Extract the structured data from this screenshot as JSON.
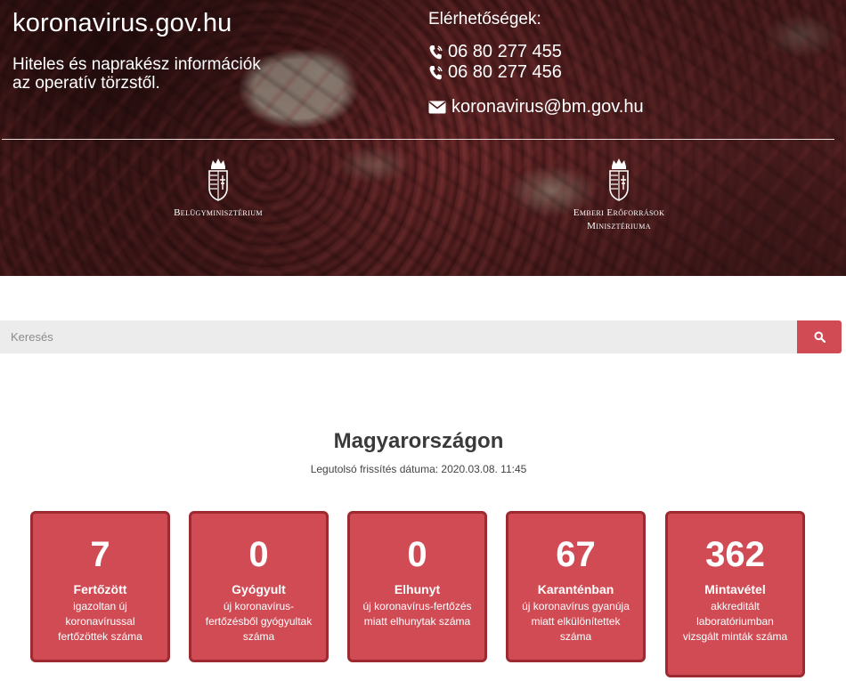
{
  "header": {
    "site_title": "koronavirus.gov.hu",
    "tagline_line1": "Hiteles és naprakész információk",
    "tagline_line2": "az operatív törzstől.",
    "contact_heading": "Elérhetőségek:",
    "phones": [
      "06 80 277 455",
      "06 80 277 456"
    ],
    "email": "koronavirus@bm.gov.hu",
    "icons": {
      "phone": "phone-icon",
      "mail": "mail-icon",
      "coat_of_arms": "coat-of-arms-icon"
    }
  },
  "ministries": [
    {
      "line1": "Belügyminisztérium",
      "line2": ""
    },
    {
      "line1": "Emberi Erőforrások",
      "line2": "Minisztériuma"
    }
  ],
  "search": {
    "placeholder": "Keresés",
    "button_icon": "search-icon"
  },
  "stats_section": {
    "title": "Magyarországon",
    "last_update": "Legutolsó frissítés dátuma: 2020.03.08. 11:45"
  },
  "stats": [
    {
      "value": "7",
      "label": "Fertőzött",
      "desc": "igazoltan új koronavírussal fertőzöttek száma"
    },
    {
      "value": "0",
      "label": "Gyógyult",
      "desc": "új koronavírus-fertőzésből gyógyultak száma"
    },
    {
      "value": "0",
      "label": "Elhunyt",
      "desc": "új koronavírus-fertőzés miatt elhunytak száma"
    },
    {
      "value": "67",
      "label": "Karanténban",
      "desc": "új koronavírus gyanúja miatt elkülönítettek száma"
    },
    {
      "value": "362",
      "label": "Mintavétel",
      "desc": "akkreditált laboratóriumban vizsgált minták száma"
    }
  ],
  "colors": {
    "accent": "#d14b55",
    "card_border": "#9e2a31",
    "search_background": "#ececec"
  }
}
